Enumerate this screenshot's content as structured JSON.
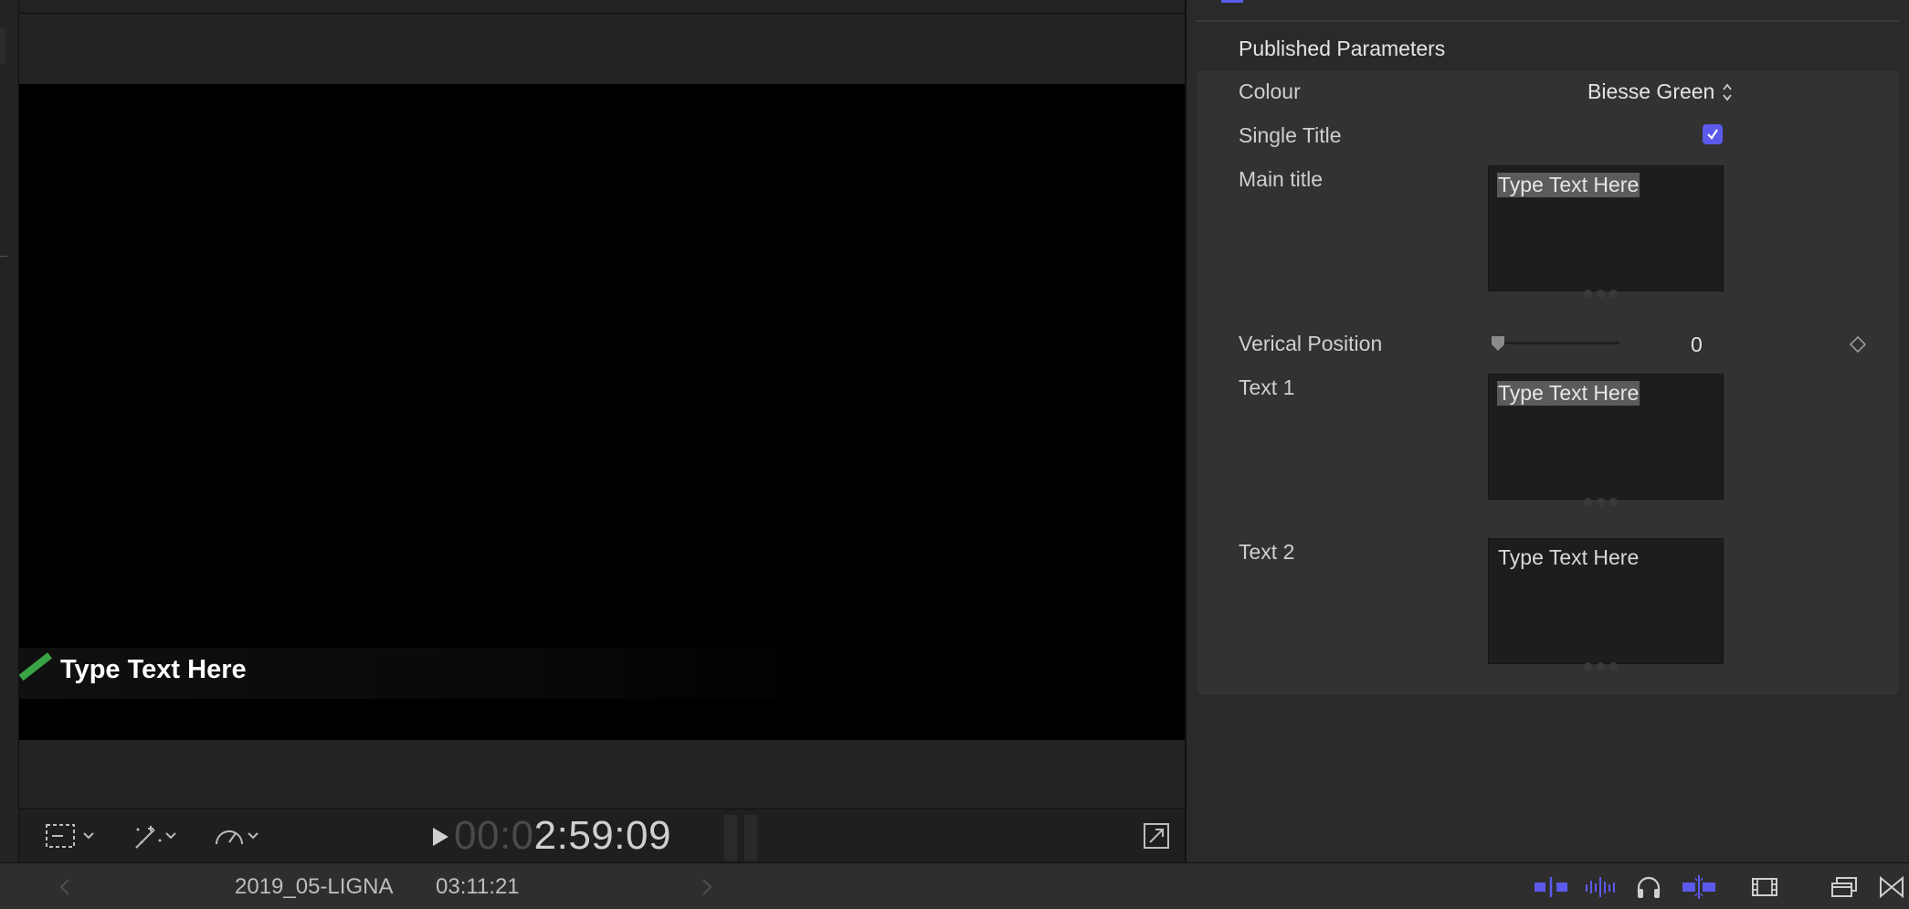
{
  "viewer": {
    "lower_third_text": "Type Text Here",
    "timecode_dim": "00:0",
    "timecode_lit": "2:59:09"
  },
  "inspector": {
    "section_title": "Published Parameters",
    "colour": {
      "label": "Colour",
      "value": "Biesse Green"
    },
    "single_title": {
      "label": "Single Title",
      "checked": true
    },
    "main_title": {
      "label": "Main title",
      "value": "Type Text Here"
    },
    "vertical_position": {
      "label": "Verical Position",
      "value": "0"
    },
    "text1": {
      "label": "Text 1",
      "value": "Type Text Here"
    },
    "text2": {
      "label": "Text 2",
      "value": "Type Text Here"
    }
  },
  "bottombar": {
    "project_name": "2019_05-LIGNA",
    "duration": "03:11:21"
  },
  "colors": {
    "accent": "#5c5aeb",
    "lower_third_green": "#3aa345"
  },
  "icons": [
    "view-options-icon",
    "transform-tools-icon",
    "retime-icon",
    "play-icon",
    "fullscreen-icon",
    "popup-arrows-icon",
    "checkmark-icon",
    "slider-thumb-icon",
    "keyframe-diamond-icon",
    "chevron-left-icon",
    "chevron-right-icon",
    "skimming-icon",
    "audio-skimming-icon",
    "headphones-icon",
    "snapping-icon",
    "clip-appearance-icon",
    "window-layout-icon",
    "transitions-icon"
  ]
}
